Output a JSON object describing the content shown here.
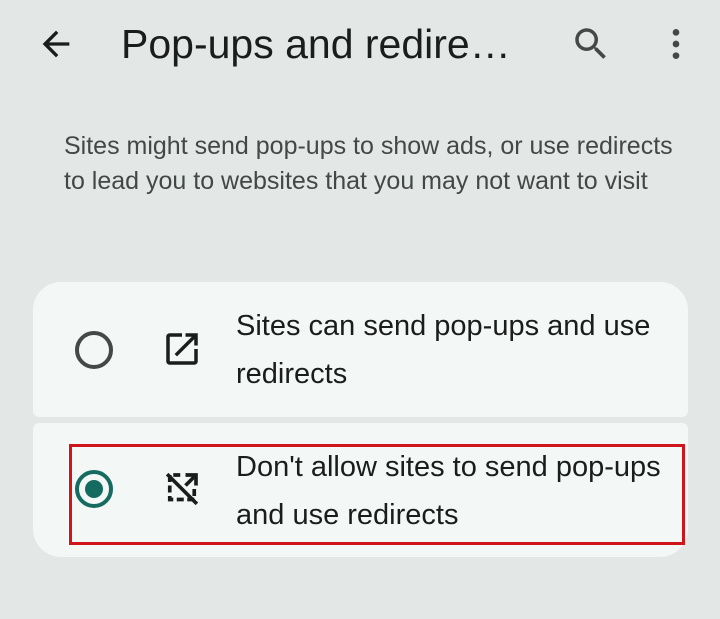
{
  "app_bar": {
    "title": "Pop-ups and redire…",
    "back_icon": "arrow-back-icon",
    "search_icon": "search-icon",
    "more_icon": "more-vert-icon"
  },
  "description": "Sites might send pop-ups to show ads, or use redirects to lead you to websites that you may not want to visit",
  "options": [
    {
      "label": "Sites can send pop-ups and use redirects",
      "icon": "open-in-new-icon",
      "selected": false
    },
    {
      "label": "Don't allow sites to send pop-ups and use redirects",
      "icon": "open-in-new-off-icon",
      "selected": true
    }
  ],
  "colors": {
    "background": "#e3e8e6",
    "card": "#f3f8f6",
    "accent": "#156b5f",
    "highlight": "#d0141c"
  }
}
